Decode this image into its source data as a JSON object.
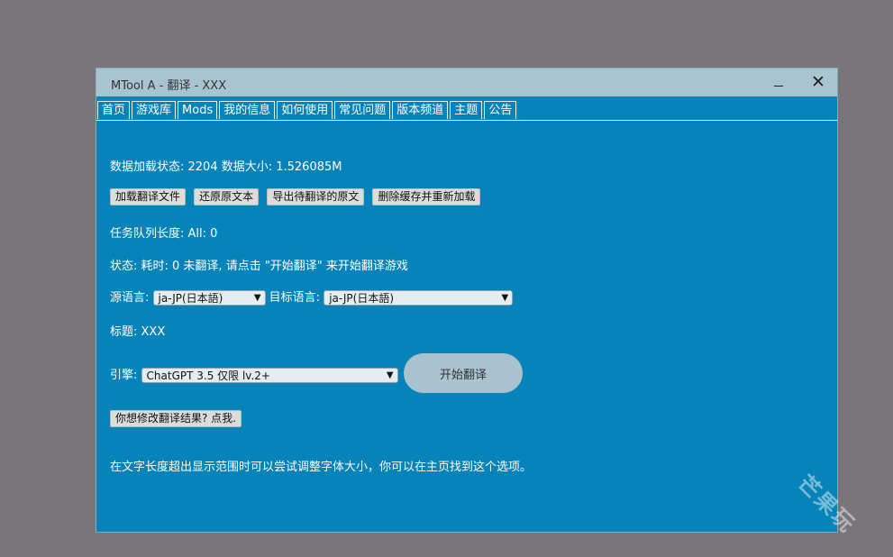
{
  "window": {
    "title": "MTool A - 翻译 - XXX",
    "minimize_label": "_",
    "close_label": "✕"
  },
  "tabs": [
    {
      "label": "首页"
    },
    {
      "label": "游戏库"
    },
    {
      "label": "Mods"
    },
    {
      "label": "我的信息"
    },
    {
      "label": "如何使用"
    },
    {
      "label": "常见问题"
    },
    {
      "label": "版本频道"
    },
    {
      "label": "主题"
    },
    {
      "label": "公告"
    }
  ],
  "main": {
    "load_status": "数据加载状态: 2204 数据大小: 1.526085M",
    "buttons": [
      {
        "label": "加载翻译文件"
      },
      {
        "label": "还原原文本"
      },
      {
        "label": "导出待翻译的原文"
      },
      {
        "label": "删除缓存并重新加载"
      }
    ],
    "queue_length": "任务队列长度: All: 0",
    "status": "状态: 耗时: 0 未翻译, 请点击 \"开始翻译\" 来开始翻译游戏",
    "source_lang_label": "源语言:",
    "source_lang_value": "ja-JP(日本語)",
    "target_lang_label": "目标语言:",
    "target_lang_value": "ja-JP(日本語)",
    "title_line": "标题: XXX",
    "engine_label": "引擎:",
    "engine_value": "ChatGPT 3.5 仅限 lv.2+",
    "start_button": "开始翻译",
    "modify_button": "你想修改翻译结果? 点我.",
    "tip": "在文字长度超出显示范围时可以尝试调整字体大小，你可以在主页找到这个选项。"
  },
  "watermark": "芒果玩",
  "colors": {
    "desktop": "#78767b",
    "window_bg": "#0683b8",
    "titlebar": "#a9c4d1",
    "button_bg": "#dcdcdc",
    "start_button_bg": "#a9c2cf"
  }
}
